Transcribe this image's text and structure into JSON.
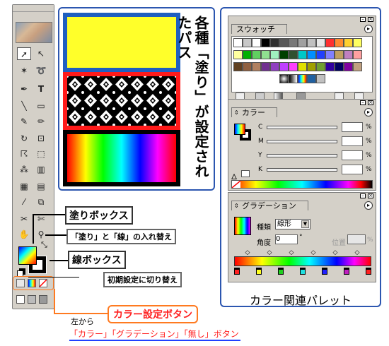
{
  "samples": {
    "vertical_title": "各種「塗り」が設定されたパス",
    "colors": {
      "blue_border": "#1f5fc0",
      "yellow": "#ffff2a",
      "red_border": "#ff1a1a"
    }
  },
  "callouts": {
    "fill_box": "塗りボックス",
    "swap": "「塗り」と「線」の入れ替え",
    "stroke_box": "線ボックス",
    "default": "初期設定に切り替え",
    "color_buttons": "カラー設定ボタン",
    "from_left": "左から",
    "buttons_list": "「カラー」「グラデーション」「無し」ボタン"
  },
  "palettes_caption": "カラー関連パレット",
  "swatch_panel": {
    "tab": "スウォッチ",
    "colors": [
      "#ffffff",
      "#c8c8c8",
      "#ffffff",
      "#000000",
      "#303030",
      "#585858",
      "#787878",
      "#a0a0a0",
      "#c0c0c0",
      "#e8e8e8",
      "#ff3030",
      "#ff8a30",
      "#ffd030",
      "#ffff60",
      "#ffffa0",
      "#00b000",
      "#60d060",
      "#90e090",
      "#a0f0c0",
      "#004000",
      "#305030",
      "#00c8c8",
      "#0090ff",
      "#2040ff",
      "#8080ff",
      "#c0a060",
      "#c080c0",
      "#ffa0a0",
      "#604020",
      "#906040",
      "#b08060",
      "#703090",
      "#9040c0",
      "#c040ff",
      "#ff40ff",
      "#e0e000",
      "#a0a000",
      "#70a030",
      "#3000a0",
      "#000060",
      "#8000a0",
      "#c0a080"
    ]
  },
  "color_panel": {
    "tab": "カラー",
    "rows": [
      {
        "label": "C",
        "unit": "%"
      },
      {
        "label": "M",
        "unit": "%"
      },
      {
        "label": "Y",
        "unit": "%"
      },
      {
        "label": "K",
        "unit": "%"
      }
    ]
  },
  "gradient_panel": {
    "tab": "グラデーション",
    "type_label": "種類",
    "type_value": "線形",
    "angle_label": "角度",
    "angle_value": "0",
    "angle_unit": "°",
    "position_label": "位置",
    "position_unit": "%",
    "stop_colors": [
      "#ff2020",
      "#ffff20",
      "#20d020",
      "#20e0e0",
      "#2020ff",
      "#c020c0",
      "#ff2020"
    ]
  }
}
